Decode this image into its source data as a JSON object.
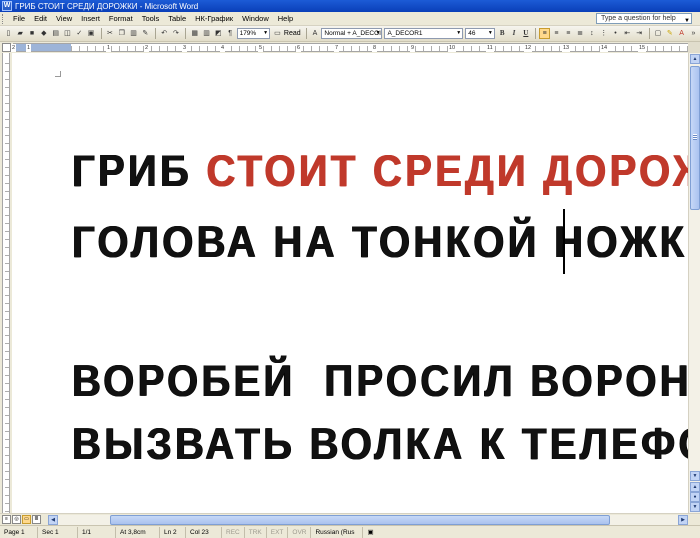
{
  "window": {
    "title": "ГРИБ СТОИТ СРЕДИ ДОРОЖКИ - Microsoft Word",
    "app_icon": "W"
  },
  "menu": {
    "items": [
      "File",
      "Edit",
      "View",
      "Insert",
      "Format",
      "Tools",
      "Table",
      "НК-График",
      "Window",
      "Help"
    ],
    "help_placeholder": "Type a question for help"
  },
  "toolbar": {
    "zoom": "179%",
    "read_label": "Read",
    "style": "Normal + A_DECOI",
    "font": "A_DECOR1",
    "font_size": "46",
    "bold": "B",
    "italic": "I",
    "underline": "U"
  },
  "ruler": {
    "numbers": [
      "1",
      "2",
      "1",
      "2",
      "3",
      "4",
      "5",
      "6",
      "7",
      "8",
      "9",
      "10",
      "11",
      "12",
      "13",
      "14",
      "15"
    ]
  },
  "document": {
    "lines": [
      {
        "black": "ГРИБ ",
        "red": "СТОИТ СРЕДИ ДОРОЖКИ"
      },
      {
        "black": "ГОЛОВА НА ТОНКОЙ НОЖКЕ",
        "red": ""
      },
      {
        "black": "ВОРОБЕЙ  ПРОСИЛ ВОРОНУ",
        "red": ""
      },
      {
        "black": "ВЫЗВАТЬ ВОЛКА К ТЕЛЕФОНУ",
        "red": ""
      }
    ],
    "colors": {
      "red": "#c0392b",
      "black": "#111111"
    }
  },
  "statusbar": {
    "page": "Page 1",
    "sec": "Sec 1",
    "pages": "1/1",
    "at": "At 3,8cm",
    "ln": "Ln 2",
    "col": "Col 23",
    "rec": "REC",
    "trk": "TRK",
    "ext": "EXT",
    "ovr": "OVR",
    "language": "Russian (Rus"
  }
}
